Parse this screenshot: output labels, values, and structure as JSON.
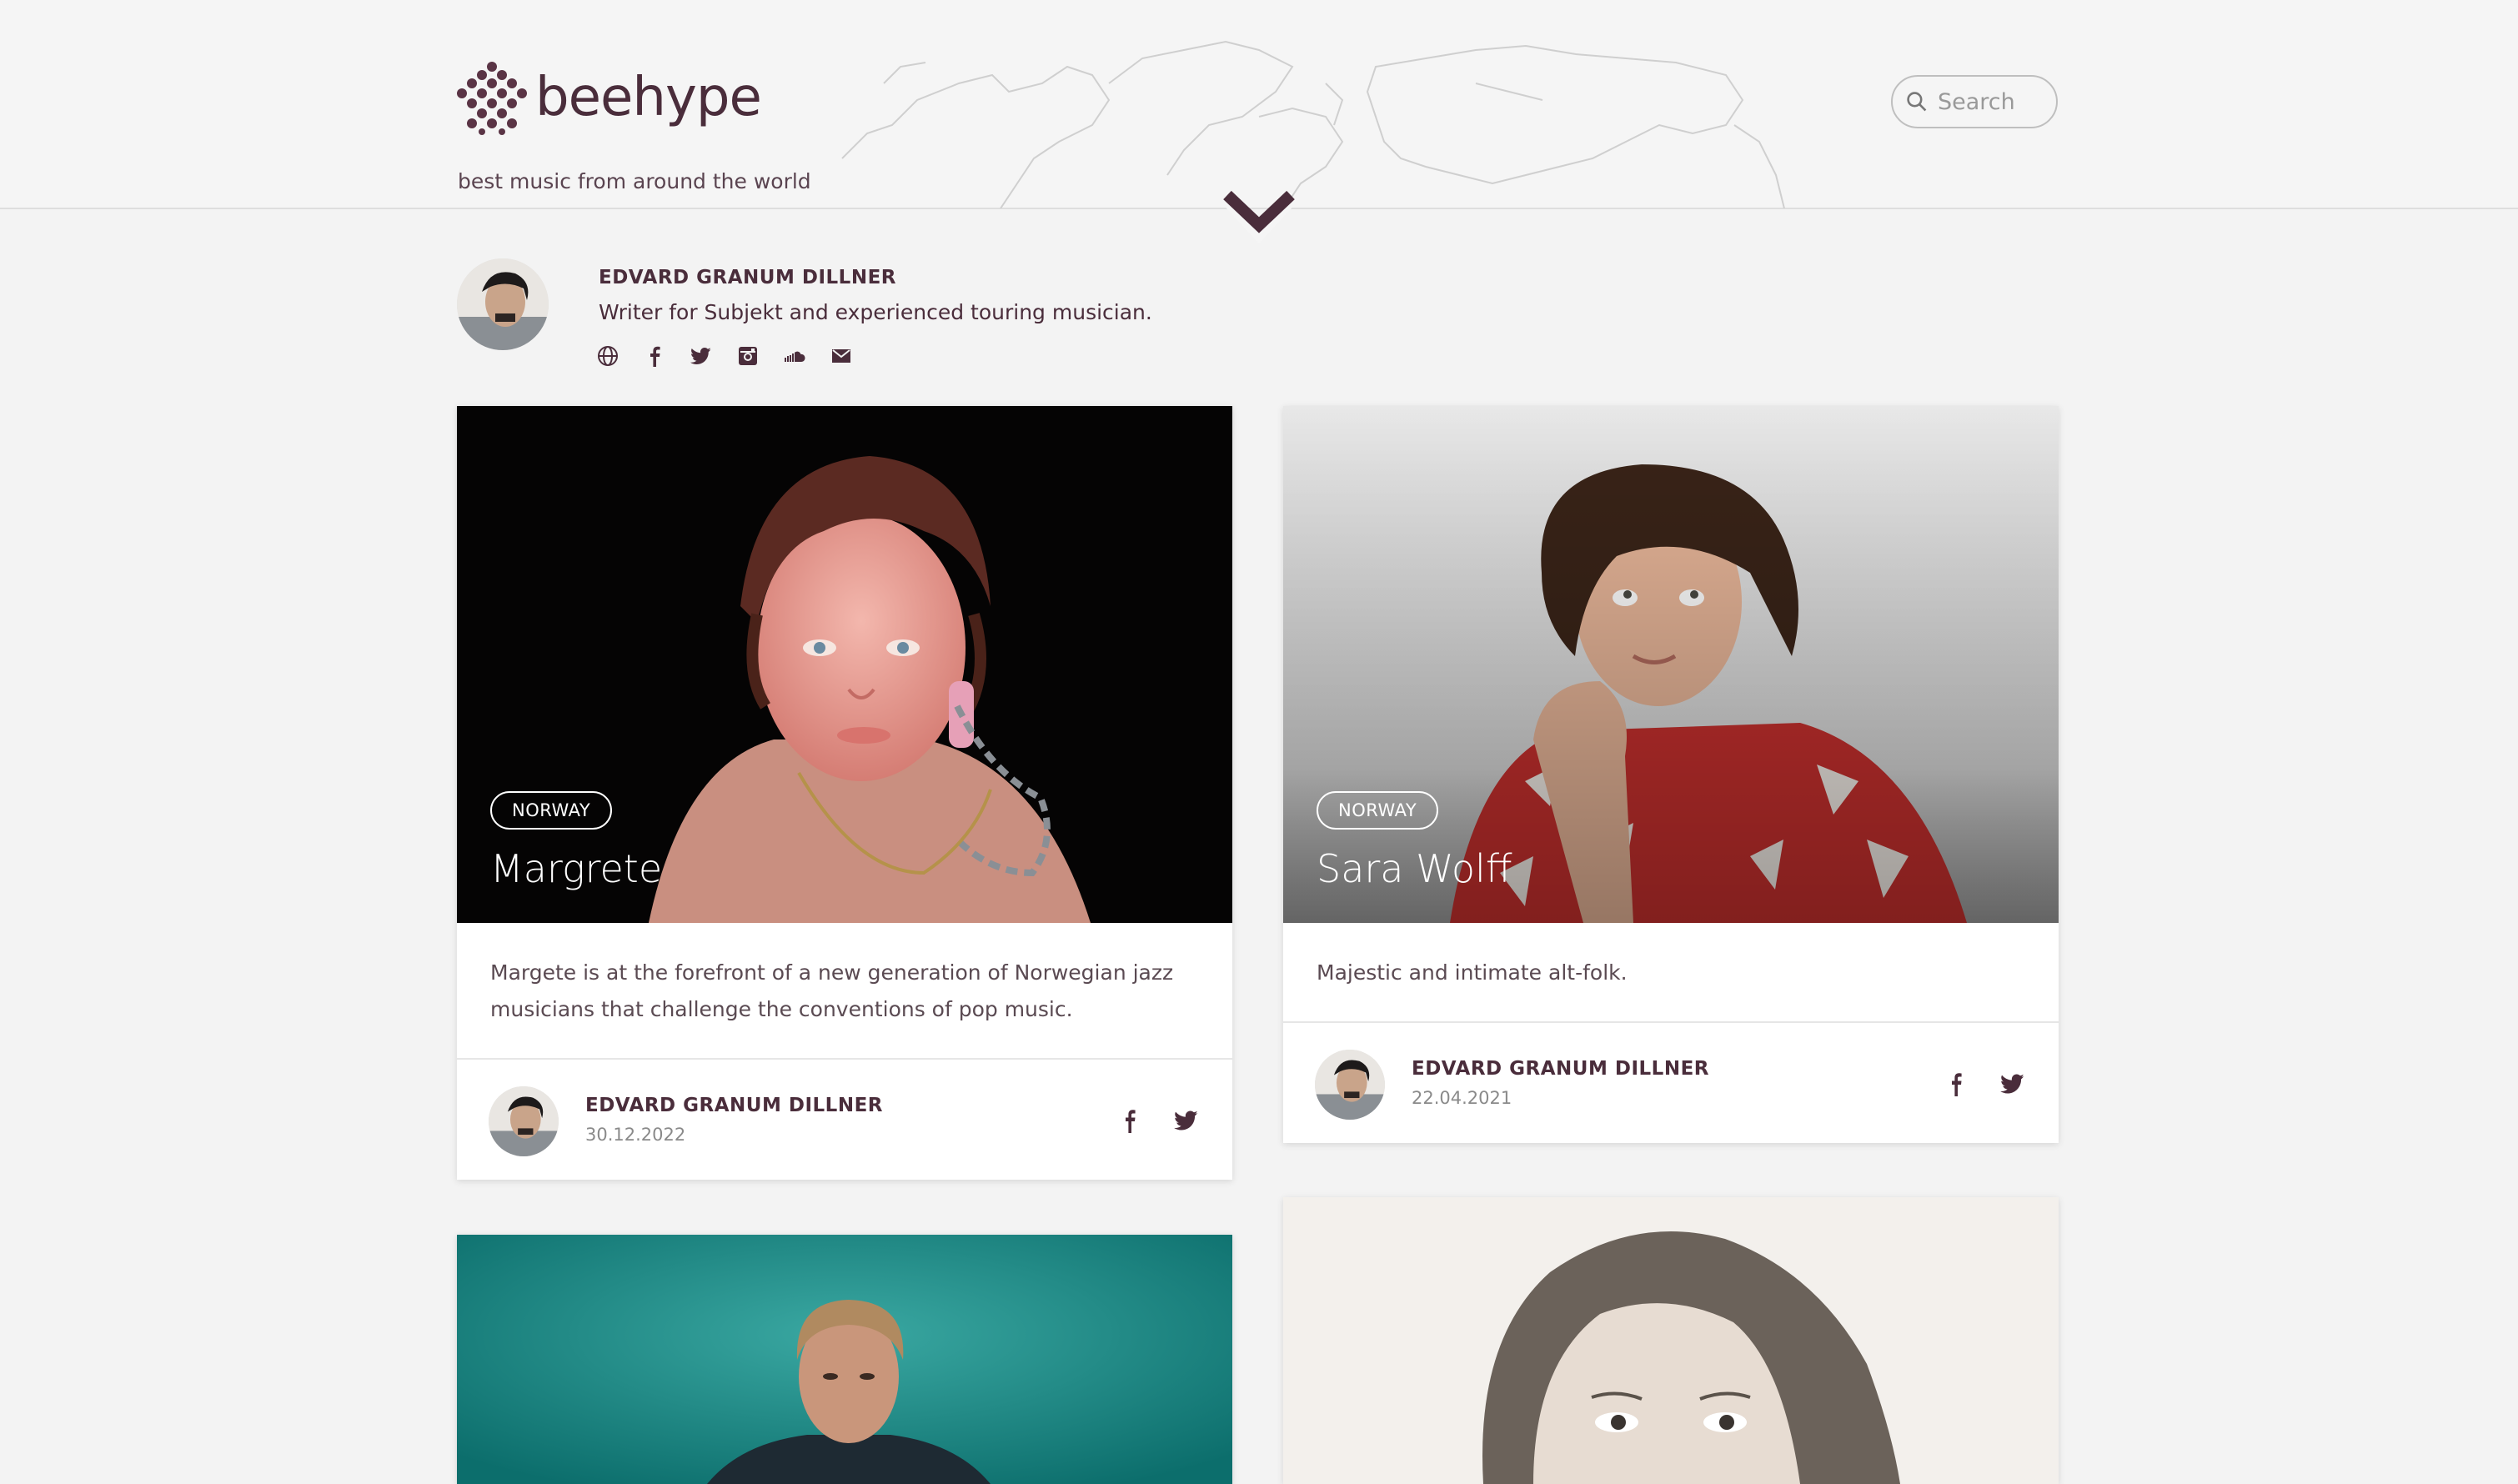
{
  "site": {
    "brand": "beehype",
    "tagline": "best music from around the world",
    "search_placeholder": "Search"
  },
  "author": {
    "name": "EDVARD GRANUM DILLNER",
    "bio": "Writer for Subjekt and experienced touring musician.",
    "social_icons": [
      "globe-icon",
      "facebook-icon",
      "twitter-icon",
      "instagram-icon",
      "soundcloud-icon",
      "mail-icon"
    ]
  },
  "cards": [
    {
      "country": "NORWAY",
      "title": "Margrete",
      "description": "Margete is at the forefront of a new generation of Norwegian jazz musicians that challenge the conventions of pop music.",
      "author": "EDVARD GRANUM DILLNER",
      "date": "30.12.2022"
    },
    {
      "country": "NORWAY",
      "title": "Sara Wolff",
      "description": "Majestic and intimate alt-folk.",
      "author": "EDVARD GRANUM DILLNER",
      "date": "22.04.2021"
    },
    {},
    {}
  ],
  "colors": {
    "brand": "#4a2d3b",
    "background": "#f3f3f3",
    "card_teal": "#1f8f8c"
  }
}
